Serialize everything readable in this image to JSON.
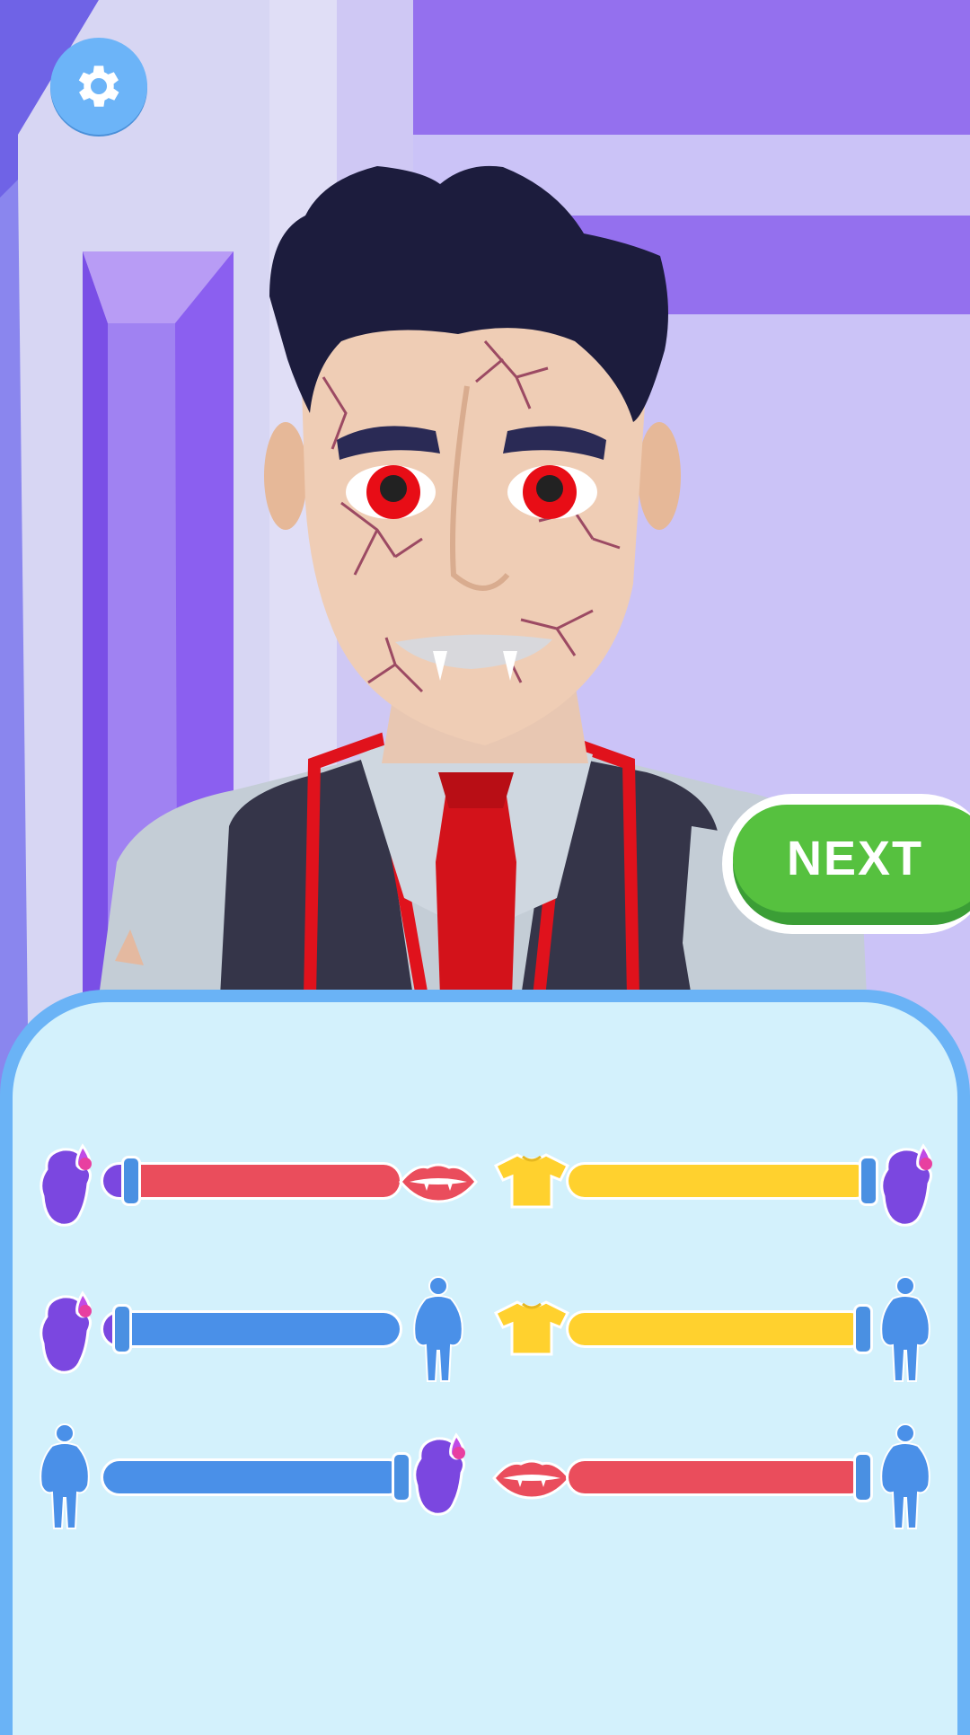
{
  "screen": {
    "next_label": "NEXT"
  },
  "colors": {
    "purple": "#7b47e0",
    "red": "#ea4d5c",
    "yellow": "#ffd12e",
    "blue": "#4a90e8",
    "accent_green": "#56c13f",
    "panel_border": "#6ab3f6",
    "panel_fill": "#d3f1fc"
  },
  "sliders": [
    {
      "name": "zombie-vampire",
      "left_icon": "zombie-head-icon",
      "right_icon": "vampire-lips-icon",
      "value": 0.1,
      "left_color": "#7b47e0",
      "right_color": "#ea4d5c"
    },
    {
      "name": "shirt-zombie",
      "left_icon": "shirt-icon",
      "right_icon": "zombie-head-icon",
      "value": 0.98,
      "left_color": "#ffd12e",
      "right_color": "#7b47e0"
    },
    {
      "name": "zombie-fat",
      "left_icon": "zombie-head-icon",
      "right_icon": "fat-body-icon",
      "value": 0.07,
      "left_color": "#7b47e0",
      "right_color": "#4a90e8"
    },
    {
      "name": "shirt-fat",
      "left_icon": "shirt-icon",
      "right_icon": "fat-body-icon",
      "value": 0.98,
      "left_color": "#ffd12e",
      "right_color": "#4a90e8"
    },
    {
      "name": "fat-zombie",
      "left_icon": "fat-body-icon",
      "right_icon": "zombie-head-icon",
      "value": 0.98,
      "left_color": "#4a90e8",
      "right_color": "#7b47e0"
    },
    {
      "name": "vampire-fat",
      "left_icon": "vampire-lips-icon",
      "right_icon": "fat-body-icon",
      "value": 0.98,
      "left_color": "#ea4d5c",
      "right_color": "#4a90e8"
    }
  ]
}
